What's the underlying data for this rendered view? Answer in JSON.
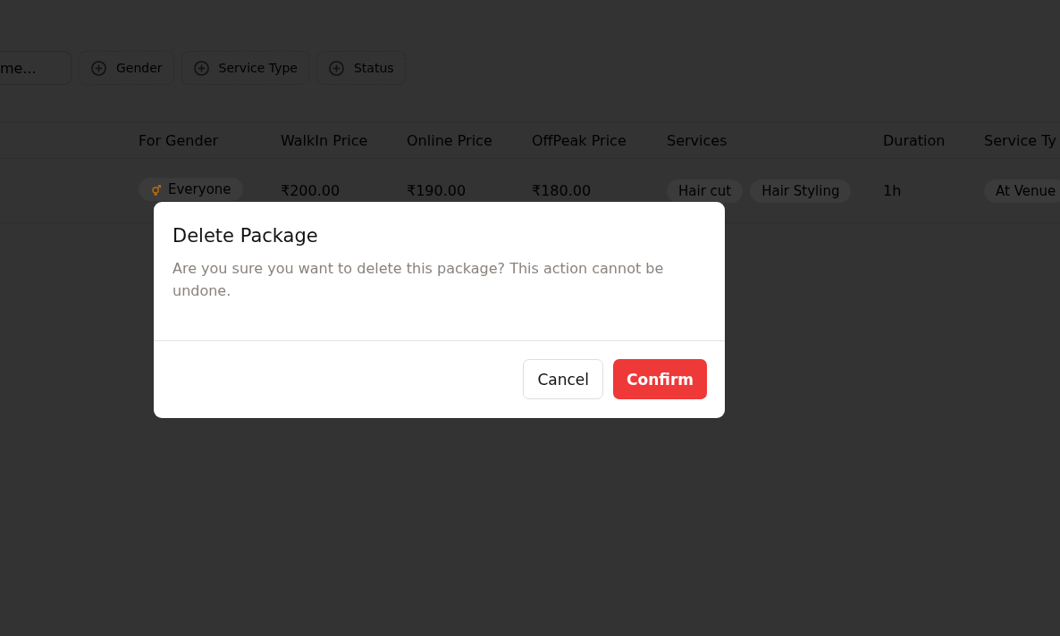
{
  "toolbar": {
    "search": {
      "placeholder": "me..."
    },
    "filters": [
      {
        "label": "Gender"
      },
      {
        "label": "Service Type"
      },
      {
        "label": "Status"
      }
    ]
  },
  "table": {
    "columns": [
      "For Gender",
      "WalkIn Price",
      "Online Price",
      "OffPeak Price",
      "Services",
      "Duration",
      "Service Ty"
    ],
    "rows": [
      {
        "gender": "Everyone",
        "walkin_price": "₹200.00",
        "online_price": "₹190.00",
        "offpeak_price": "₹180.00",
        "services": [
          "Hair cut",
          "Hair Styling"
        ],
        "duration": "1h",
        "service_type": "At Venue"
      }
    ]
  },
  "dialog": {
    "title": "Delete Package",
    "message": "Are you sure you want to delete this package? This action cannot be undone.",
    "buttons": [
      {
        "label": "Cancel",
        "kind": "secondary"
      },
      {
        "label": "Confirm",
        "kind": "danger"
      }
    ]
  }
}
